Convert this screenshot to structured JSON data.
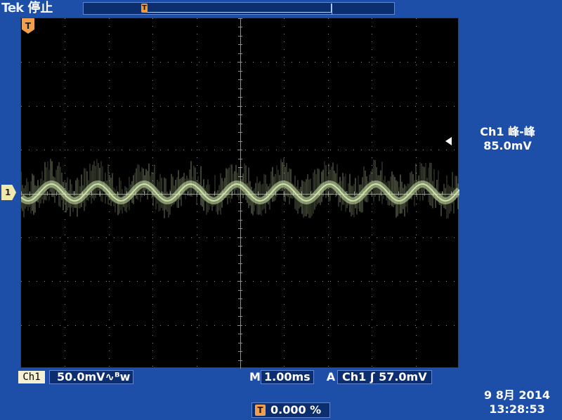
{
  "header": {
    "brand": "Tek",
    "status": "停止",
    "time_marker_label": "T"
  },
  "screen": {
    "trigger_marker_label": "T",
    "channel_marker_label": "1"
  },
  "measurement": {
    "title": "Ch1 峰-峰",
    "value": "85.0mV"
  },
  "bottom": {
    "channel": "Ch1",
    "volts_per_div": "50.0mV",
    "coupling_glyph": "∿",
    "bw_glyph": "ᴮw",
    "timebase_label": "M",
    "timebase_value": "1.00ms",
    "acq_label": "A",
    "trigger_channel": "Ch1",
    "trigger_slope": "ʃ",
    "trigger_level": "57.0mV",
    "position_value": "0.000 %",
    "position_icon": "T"
  },
  "datetime": {
    "date": "9 8月 2014",
    "time": "13:28:53"
  },
  "colors": {
    "background": "#1e4fa8",
    "screen_bg": "#000000",
    "grid": "#8f8f8f",
    "trace": "#d2e7ad",
    "marker": "#f2a04c"
  }
}
